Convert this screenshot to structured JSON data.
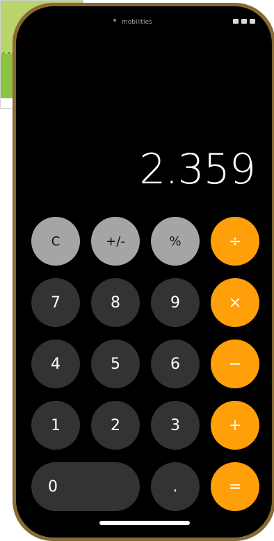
{
  "status_bar": {
    "title": "mobilities"
  },
  "display": {
    "value": "2.359"
  },
  "keypad": {
    "rows": [
      [
        {
          "label": "C",
          "style": "gray"
        },
        {
          "label": "+/-",
          "style": "gray"
        },
        {
          "label": "%",
          "style": "gray"
        },
        {
          "label": "÷",
          "style": "orange"
        }
      ],
      [
        {
          "label": "7",
          "style": "dark"
        },
        {
          "label": "8",
          "style": "dark"
        },
        {
          "label": "9",
          "style": "dark"
        },
        {
          "label": "×",
          "style": "orange"
        }
      ],
      [
        {
          "label": "4",
          "style": "dark"
        },
        {
          "label": "5",
          "style": "dark"
        },
        {
          "label": "6",
          "style": "dark"
        },
        {
          "label": "−",
          "style": "orange"
        }
      ],
      [
        {
          "label": "1",
          "style": "dark"
        },
        {
          "label": "2",
          "style": "dark"
        },
        {
          "label": "3",
          "style": "dark"
        },
        {
          "label": "+",
          "style": "orange"
        }
      ],
      [
        {
          "label": "0",
          "style": "dark",
          "wide": true
        },
        {
          "label": ".",
          "style": "dark"
        },
        {
          "label": "=",
          "style": "orange"
        }
      ]
    ]
  },
  "colors": {
    "accent": "#ff9f0a",
    "key_dark": "#333333",
    "key_gray": "#a5a5a5",
    "frame": "#8a6a33",
    "card_light_green": "#b8d46a",
    "card_green": "#8cc341"
  }
}
